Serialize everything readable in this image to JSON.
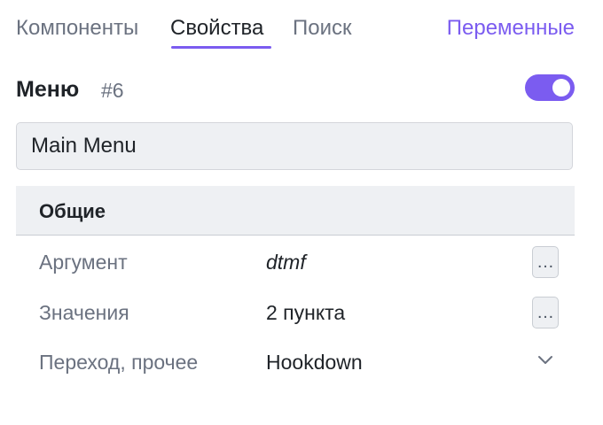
{
  "tabs": {
    "items": [
      {
        "label": "Компоненты",
        "active": false
      },
      {
        "label": "Свойства",
        "active": true
      },
      {
        "label": "Поиск",
        "active": false
      }
    ],
    "variables_label": "Переменные"
  },
  "header": {
    "title": "Меню",
    "id": "#6",
    "toggle_on": true
  },
  "name_field": {
    "value": "Main Menu"
  },
  "section": {
    "title": "Общие",
    "rows": [
      {
        "label": "Аргумент",
        "value": "dtmf",
        "control": "more-button"
      },
      {
        "label": "Значения",
        "value": "2 пункта",
        "control": "more-button"
      },
      {
        "label": "Переход, прочее",
        "value": "Hookdown",
        "control": "chevron-down"
      }
    ]
  },
  "colors": {
    "accent": "#7b5cf0",
    "muted_text": "#6b7280",
    "panel_bg": "#eef0f3"
  },
  "icons": {
    "more": "…"
  }
}
